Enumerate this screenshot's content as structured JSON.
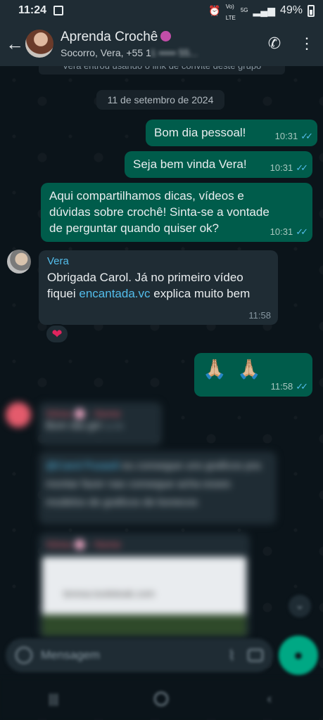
{
  "status_bar": {
    "time": "11:24",
    "network_top": "Vo)",
    "network_bottom": "LTE",
    "network_type": "5G",
    "battery": "49%"
  },
  "header": {
    "back_icon": "back-arrow-icon",
    "title": "Aprenda Crochê",
    "subtitle_visible": "Socorro, Vera, +55 1",
    "subtitle_blurred": "1 ••••• 55...",
    "actions": [
      "add-call-icon",
      "more-vert-icon"
    ]
  },
  "chat": {
    "system_message": "Vera entrou usando o link de convite deste grupo",
    "date_chip": "11 de setembro de 2024",
    "messages": [
      {
        "text": "Bom dia pessoal!",
        "time": "10:31"
      },
      {
        "text": "Seja bem vinda Vera!",
        "time": "10:31"
      },
      {
        "text": "Aqui compartilhamos dicas, vídeos e dúvidas sobre crochê! Sinta-se a vontade de perguntar quando quiser ok?",
        "time": "10:31"
      },
      {
        "sender": "Vera",
        "text_before_link": "Obrigada Carol. Já no primeiro vídeo fiquei ",
        "link": "encantada.vc",
        "text_after_link": " explica muito bem",
        "time": "11:58",
        "reaction": "❤"
      },
      {
        "text": "🙏🏼 🙏🏼",
        "time": "11:58"
      }
    ],
    "blurred": {
      "sender1": "Sônia 🌸 - Nome",
      "line1": "Bom dia giri",
      "time1": "11:59",
      "mention": "@Carol Pusaoli",
      "line2": "eu consegue uns graficos pra montar fazer",
      "line3": "nao consegue acha esses modelos de graficos de bonecos",
      "sender2": "Sônia 🌸 - Nome",
      "preview_url": "teresa.tooleteak.com"
    }
  },
  "composer": {
    "placeholder": "Mensagem"
  },
  "colors": {
    "header_bg": "#1f2c34",
    "outgoing_bubble": "#005c4b",
    "incoming_bubble": "#1f2c34",
    "read_ticks": "#53bdeb",
    "accent": "#00a884"
  }
}
